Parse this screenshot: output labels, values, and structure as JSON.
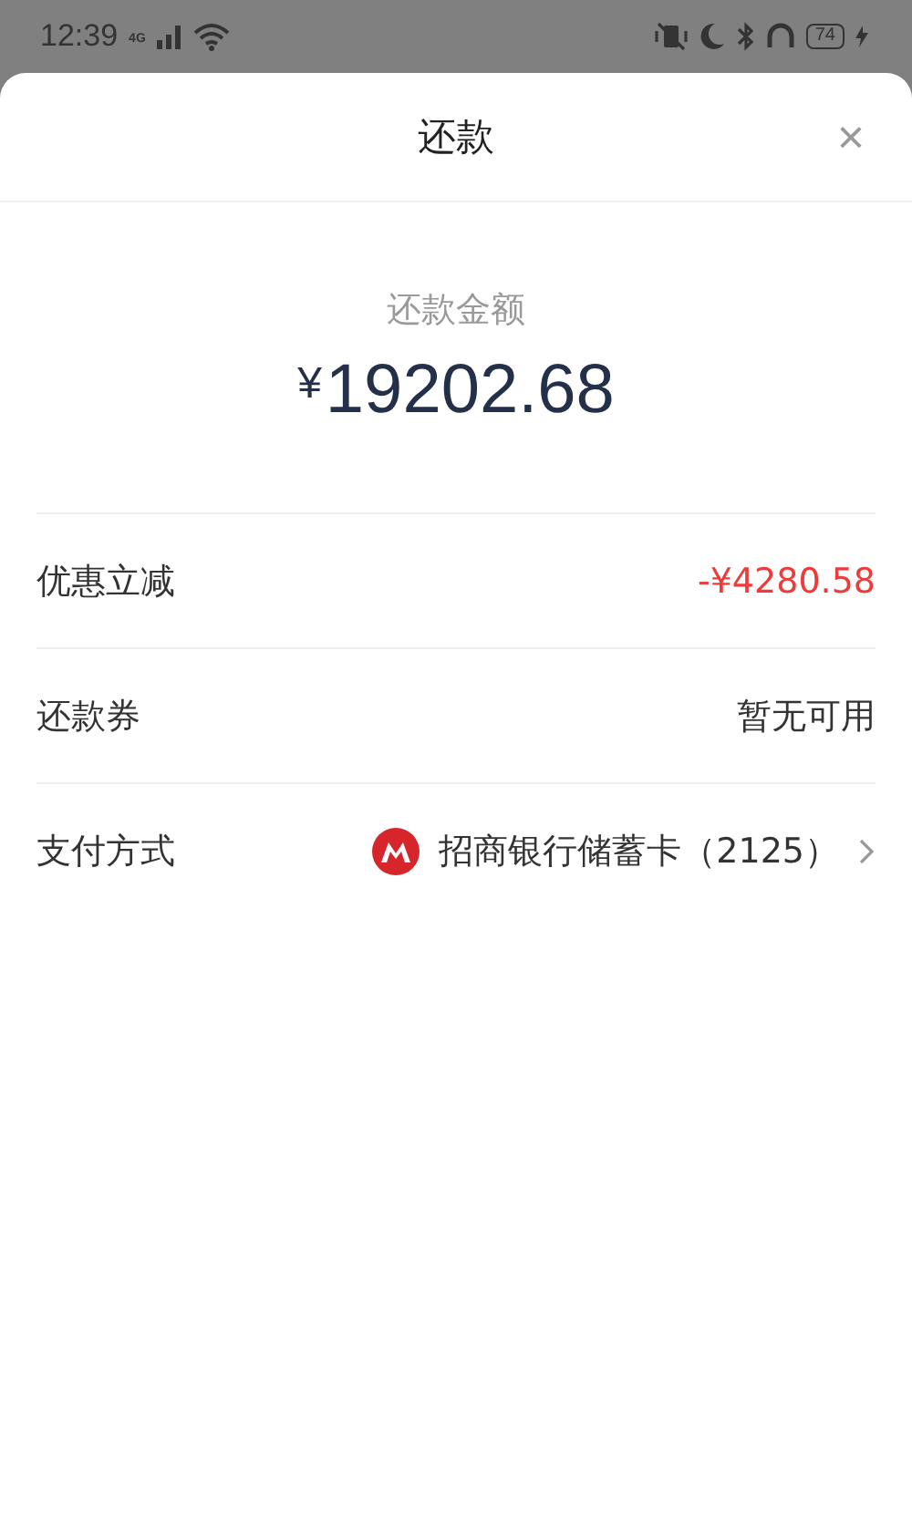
{
  "status_bar": {
    "time": "12:39",
    "network": "4G",
    "battery": "74"
  },
  "sheet": {
    "title": "还款",
    "close": "×"
  },
  "amount": {
    "label": "还款金额",
    "currency": "¥",
    "value": "19202.68"
  },
  "rows": [
    {
      "kind": "discount",
      "label": "优惠立减",
      "value": "-¥4280.58"
    },
    {
      "kind": "plain",
      "label": "还款券",
      "value": "暂无可用"
    },
    {
      "kind": "payment",
      "label": "支付方式",
      "value": "招商银行储蓄卡（2125）"
    }
  ]
}
